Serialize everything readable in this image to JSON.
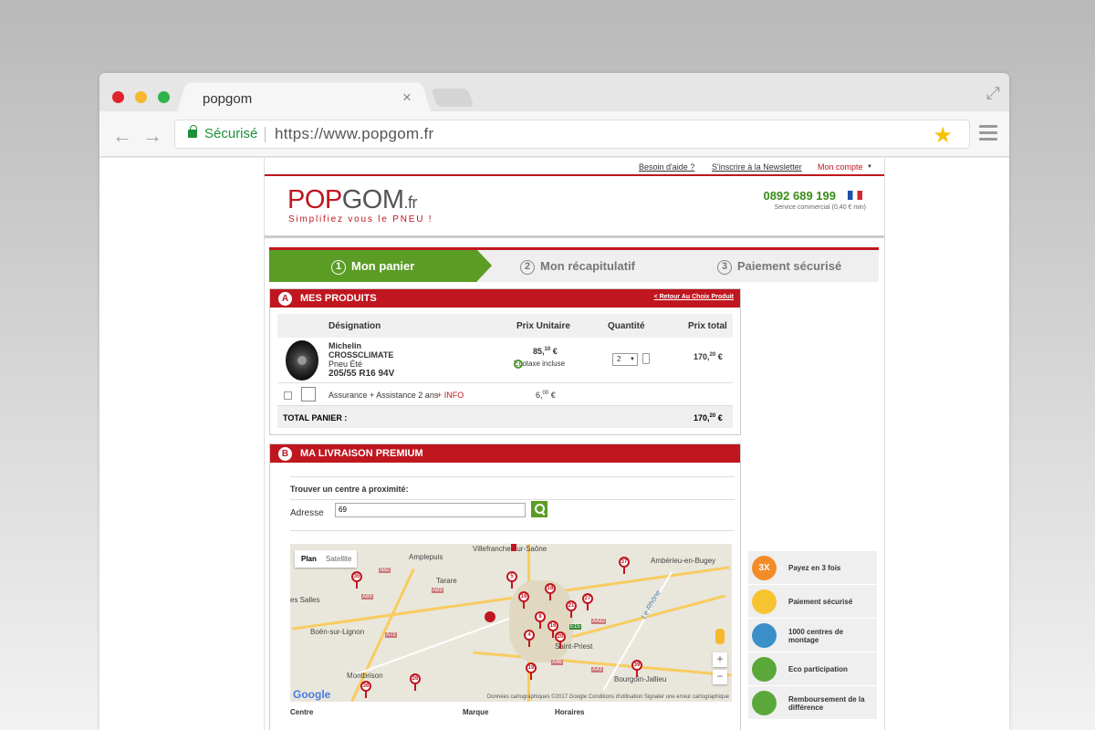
{
  "browser": {
    "tab_title": "popgom",
    "tab_close": "×",
    "secure_label": "Sécurisé",
    "url": "https://www.popgom.fr",
    "back_arrow": "←",
    "forward_arrow": "→",
    "expand_glyph": "⤢",
    "star_glyph": "★"
  },
  "toplinks": {
    "help": "Besoin d'aide ?",
    "newsletter": "S'inscrire à la Newsletter",
    "account": "Mon compte",
    "account_caret": "▼"
  },
  "header": {
    "logo_pop": "POP",
    "logo_gom": "GOM",
    "logo_fr": ".fr",
    "tagline": "Simplifiez vous le PNEU !",
    "phone": "0892 689 199",
    "phone_sub": "Service commercial (0,40 € min)"
  },
  "steps": [
    {
      "num": "1",
      "label": "Mon panier"
    },
    {
      "num": "2",
      "label": "Mon récapitulatif"
    },
    {
      "num": "3",
      "label": "Paiement sécurisé"
    }
  ],
  "products": {
    "badge": "A",
    "title": "MES PRODUITS",
    "back_link": "< Retour Au Choix Produit",
    "columns": {
      "designation": "Désignation",
      "unit_price": "Prix Unitaire",
      "quantity": "Quantité",
      "total_price": "Prix total"
    },
    "item": {
      "brand": "Michelin",
      "model": "CROSSCLIMATE",
      "season": "Pneu Été",
      "size": "205/55 R16 94V",
      "price_main": "85,",
      "price_cents": "10",
      "price_currency": " €",
      "ecotax": "Ecotaxe incluse",
      "qty": "2",
      "qty_caret": "▼",
      "total_main": "170,",
      "total_cents": "20",
      "total_currency": " €"
    },
    "insurance": {
      "label": "Assurance + Assistance 2 ans",
      "info": "+ INFO",
      "price_main": "6,",
      "price_cents": "00",
      "price_currency": " €"
    },
    "total": {
      "label": "TOTAL PANIER :",
      "main": "170,",
      "cents": "20",
      "currency": " €"
    }
  },
  "delivery": {
    "badge": "B",
    "title": "MA LIVRAISON PREMIUM",
    "find_center": "Trouver un centre à proximité:",
    "address_label": "Adresse",
    "address_value": "69",
    "map": {
      "tab_plan": "Plan",
      "tab_satellite": "Satellite",
      "places": {
        "villefranche": "Villefranche-sur-Saône",
        "amplepuis": "Amplepuis",
        "tarare": "Tarare",
        "salles": "es Salles",
        "boen": "Boën-sur-Lignon",
        "montbrison": "Montbrison",
        "amberieu": "Ambérieu-en-Bugey",
        "saintpriest": "Saint-Priest",
        "bourgoin": "Bourgoin-Jallieu",
        "rhone": "Le Rhône"
      },
      "roads": {
        "n82": "N82",
        "a89": "A89",
        "a89b": "A89",
        "a72": "A72",
        "a432": "A432",
        "e15": "E15",
        "a43": "A43",
        "a46": "A46"
      },
      "pins": [
        "35",
        "5",
        "37",
        "18",
        "16",
        "27",
        "21",
        "8",
        "16",
        "20",
        "4",
        "19",
        "26",
        "36",
        "39"
      ],
      "google": "Google",
      "footer": "Données cartographiques ©2017 Google    Conditions d'utilisation    Signaler une erreur cartographique",
      "zoom_in": "+",
      "zoom_out": "−"
    },
    "list_columns": {
      "center": "Centre",
      "brand": "Marque",
      "hours": "Horaires"
    }
  },
  "benefits": [
    {
      "icon": "3X",
      "label": "Payez en 3 fois",
      "color": "#f28c28"
    },
    {
      "icon": "",
      "label": "Paiement sécurisé",
      "color": "#f7c431"
    },
    {
      "icon": "",
      "label": "1000 centres de montage",
      "color": "#3a8fc9"
    },
    {
      "icon": "",
      "label": "Eco participation",
      "color": "#5ba83a"
    },
    {
      "icon": "",
      "label": "Remboursement de la différence",
      "color": "#5ba83a"
    }
  ]
}
